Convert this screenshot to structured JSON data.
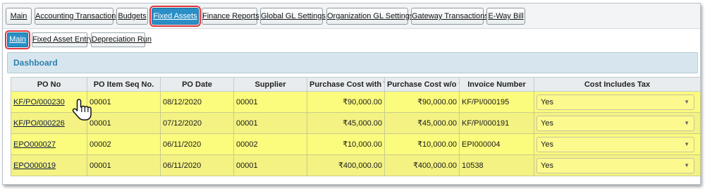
{
  "tabs": [
    {
      "label": "Main",
      "active": false
    },
    {
      "label": "Accounting Transaction",
      "active": false
    },
    {
      "label": "Budgets",
      "active": false
    },
    {
      "label": "Fixed Assets",
      "active": true
    },
    {
      "label": "Finance Reports",
      "active": false
    },
    {
      "label": "Global GL Settings",
      "active": false
    },
    {
      "label": "Organization GL Settings",
      "active": false
    },
    {
      "label": "Gateway Transactions",
      "active": false
    },
    {
      "label": "E-Way Bill",
      "active": false
    }
  ],
  "subtabs": [
    {
      "label": "Main",
      "active": true
    },
    {
      "label": "Fixed Asset Entry",
      "active": false
    },
    {
      "label": "Depreciation Run",
      "active": false
    }
  ],
  "dashboard": {
    "title": "Dashboard"
  },
  "table": {
    "columns": [
      "PO No",
      "PO Item Seq No.",
      "PO Date",
      "Supplier",
      "Purchase Cost with Tax",
      "Purchase Cost w/o tax",
      "Invoice Number",
      "Cost Includes Tax"
    ],
    "rows": [
      {
        "po_no": "KF/PO/000230",
        "seq": "00001",
        "date": "08/12/2020",
        "supplier": "00001",
        "cost_tax": "₹90,000.00",
        "cost_wo_tax": "₹90,000.00",
        "invoice": "KF/PI/000195",
        "includes_tax": "Yes"
      },
      {
        "po_no": "KF/PO/000226",
        "seq": "00001",
        "date": "07/12/2020",
        "supplier": "00001",
        "cost_tax": "₹45,000.00",
        "cost_wo_tax": "₹45,000.00",
        "invoice": "KF/PI/000191",
        "includes_tax": "Yes"
      },
      {
        "po_no": "EPO000027",
        "seq": "00002",
        "date": "06/11/2020",
        "supplier": "00002",
        "cost_tax": "₹10,000.00",
        "cost_wo_tax": "₹10,000.00",
        "invoice": "EPI000004",
        "includes_tax": "Yes"
      },
      {
        "po_no": "EPO000019",
        "seq": "00001",
        "date": "06/11/2020",
        "supplier": "00001",
        "cost_tax": "₹400,000.00",
        "cost_wo_tax": "₹400,000.00",
        "invoice": "10538",
        "includes_tax": "Yes"
      }
    ]
  },
  "icons": {
    "cursor": "hand-pointer-icon",
    "dropdown": "triangle-down-icon"
  },
  "colors": {
    "accent": "#2a8fc6",
    "highlight": "#e0353d",
    "row_yellow": "#fbfb7d",
    "header_text": "#2d7fae"
  }
}
